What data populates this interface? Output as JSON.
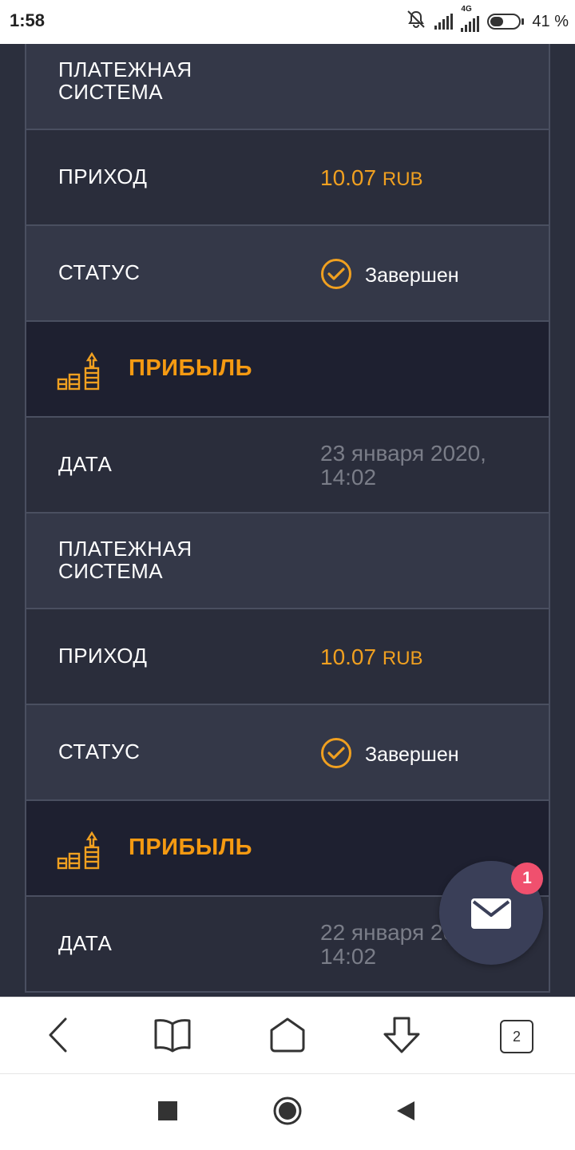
{
  "status_bar": {
    "time": "1:58",
    "network": "4G",
    "battery_percent": "41 %"
  },
  "entries": [
    {
      "payment_system_label": "ПЛАТЕЖНАЯ СИСТЕМА",
      "income_label": "ПРИХОД",
      "income_amount": "10.07",
      "income_currency": "RUB",
      "status_label": "СТАТУС",
      "status_value": "Завершен"
    },
    {
      "header_title": "ПРИБЫЛЬ",
      "date_label": "ДАТА",
      "date_value": "23 января 2020, 14:02",
      "payment_system_label": "ПЛАТЕЖНАЯ СИСТЕМА",
      "income_label": "ПРИХОД",
      "income_amount": "10.07",
      "income_currency": "RUB",
      "status_label": "СТАТУС",
      "status_value": "Завершен"
    },
    {
      "header_title": "ПРИБЫЛЬ",
      "date_label": "ДАТА",
      "date_value": "22 января 2020, 14:02"
    }
  ],
  "chat": {
    "badge_count": "1",
    "icon": "mail-icon"
  },
  "browser_nav": {
    "tabs_count": "2"
  },
  "colors": {
    "accent": "#f59a12",
    "background": "#2b2f3d",
    "header_row": "#1e2030",
    "badge": "#f0506e"
  }
}
